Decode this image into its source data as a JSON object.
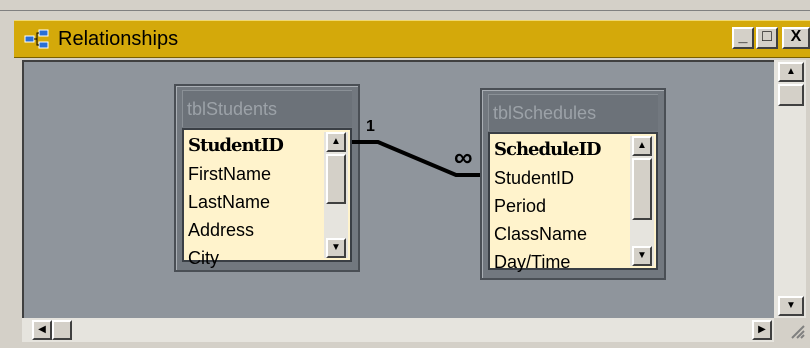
{
  "window": {
    "title": "Relationships",
    "controls": {
      "minimize": "_",
      "maximize": "□",
      "close": "X"
    }
  },
  "tables": [
    {
      "name": "tblStudents",
      "fields": [
        "StudentID",
        "FirstName",
        "LastName",
        "Address",
        "City"
      ],
      "primary_key": "StudentID"
    },
    {
      "name": "tblSchedules",
      "fields": [
        "ScheduleID",
        "StudentID",
        "Period",
        "ClassName",
        "Day/Time"
      ],
      "primary_key": "ScheduleID"
    }
  ],
  "relationship": {
    "from_field": "StudentID",
    "to_field": "StudentID",
    "one_label": "1",
    "many_label": "∞"
  },
  "colors": {
    "titlebar": "#d4a90a",
    "canvas": "#8f959c",
    "field_list": "#fff3cc"
  }
}
